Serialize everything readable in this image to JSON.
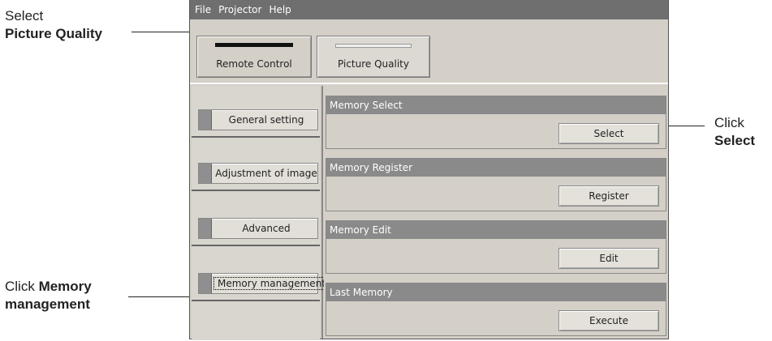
{
  "annotations": {
    "picture_quality": {
      "line1": "Select",
      "line2": "Picture Quality"
    },
    "memory_management": {
      "prefix": "Click ",
      "bold1": "Memory",
      "bold2": "management"
    },
    "select": {
      "line1": "Click",
      "line2": "Select"
    }
  },
  "menu": [
    "File",
    "Projector",
    "Help"
  ],
  "toolbar": {
    "remote_control": "Remote Control",
    "picture_quality": "Picture Quality"
  },
  "nav": [
    {
      "label": "General setting",
      "active": false
    },
    {
      "label": "Adjustment of image",
      "active": false
    },
    {
      "label": "Advanced",
      "active": false
    },
    {
      "label": "Memory management",
      "active": true
    }
  ],
  "sections": [
    {
      "title": "Memory Select",
      "button": "Select"
    },
    {
      "title": "Memory Register",
      "button": "Register"
    },
    {
      "title": "Memory Edit",
      "button": "Edit"
    },
    {
      "title": "Last Memory",
      "button": "Execute"
    }
  ]
}
